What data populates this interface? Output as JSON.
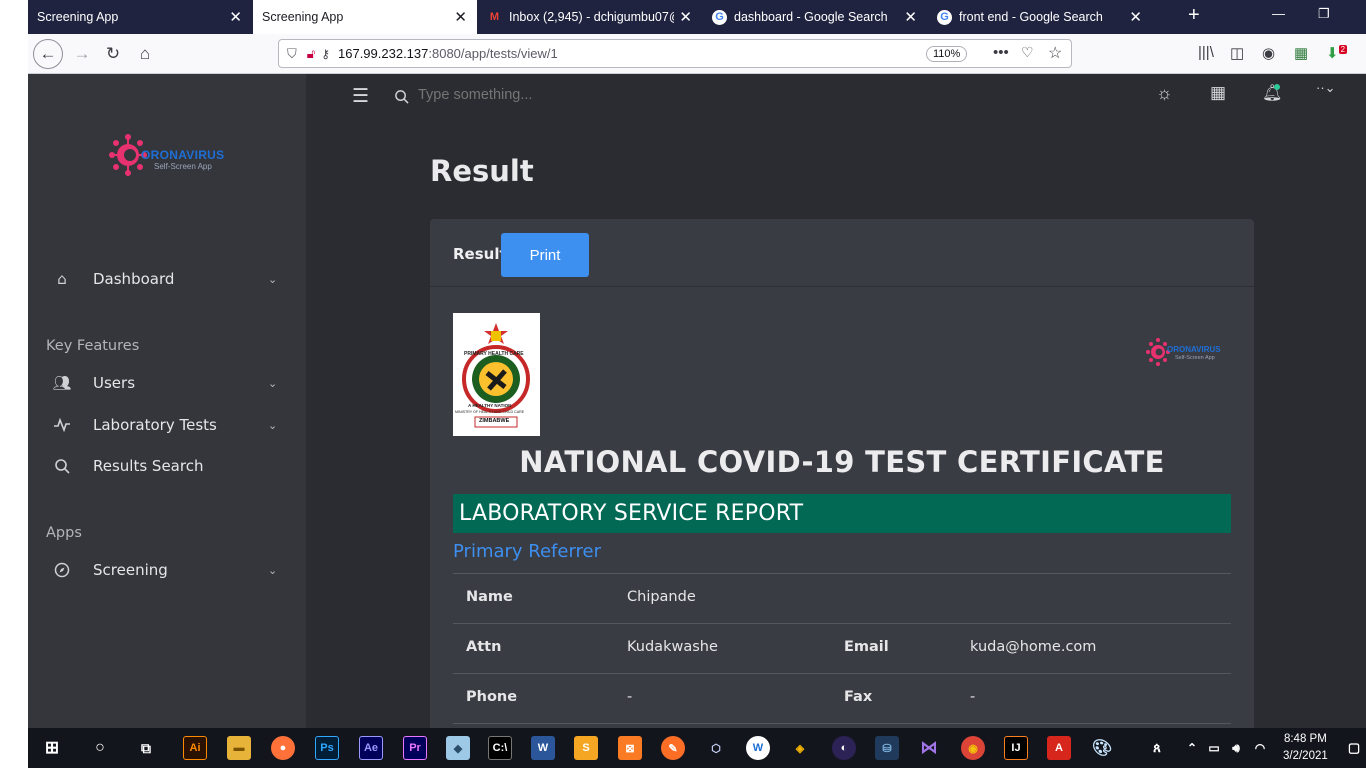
{
  "browser": {
    "tabs": [
      {
        "title": "Screening App",
        "active": false
      },
      {
        "title": "Screening App",
        "active": true
      },
      {
        "title": "Inbox (2,945) - dchigumbu07@",
        "active": false
      },
      {
        "title": "dashboard - Google Search",
        "active": false
      },
      {
        "title": "front end - Google Search",
        "active": false
      }
    ],
    "url_host": "167.99.232.137",
    "url_path": ":8080/app/tests/view/1",
    "zoom": "110%"
  },
  "sidebar": {
    "logo_text": "ORONAVIRUS",
    "logo_sub": "Self-Screen App",
    "dashboard": "Dashboard",
    "section_key": "Key Features",
    "users": "Users",
    "lab_tests": "Laboratory Tests",
    "results_search": "Results Search",
    "section_apps": "Apps",
    "screening": "Screening"
  },
  "topbar": {
    "search_placeholder": "Type something..."
  },
  "main": {
    "title": "Result",
    "card_label": "Result",
    "print_label": "Print",
    "cert_title": "NATIONAL COVID-19 TEST CERTIFICATE",
    "lab_report": "LABORATORY SERVICE REPORT",
    "primary_referrer": "Primary Referrer",
    "rows": [
      {
        "k1": "Name",
        "v1": "Chipande",
        "k2": "",
        "v2": ""
      },
      {
        "k1": "Attn",
        "v1": "Kudakwashe",
        "k2": "Email",
        "v2": "kuda@home.com"
      },
      {
        "k1": "Phone",
        "v1": "-",
        "k2": "Fax",
        "v2": "-"
      }
    ]
  },
  "crest": {
    "arc_top": "PRIMARY HEALTH CARE",
    "arc_mid": "A HEALTHY NATION",
    "arc_low": "MINISTRY OF HEALTH AND CHILD CARE",
    "country": "ZIMBABWE"
  },
  "taskbar": {
    "time": "8:48 PM",
    "date": "3/2/2021"
  },
  "colors": {
    "accent": "#3d8ff0",
    "report_bar": "#026955",
    "logo_pink": "#e8316f"
  }
}
